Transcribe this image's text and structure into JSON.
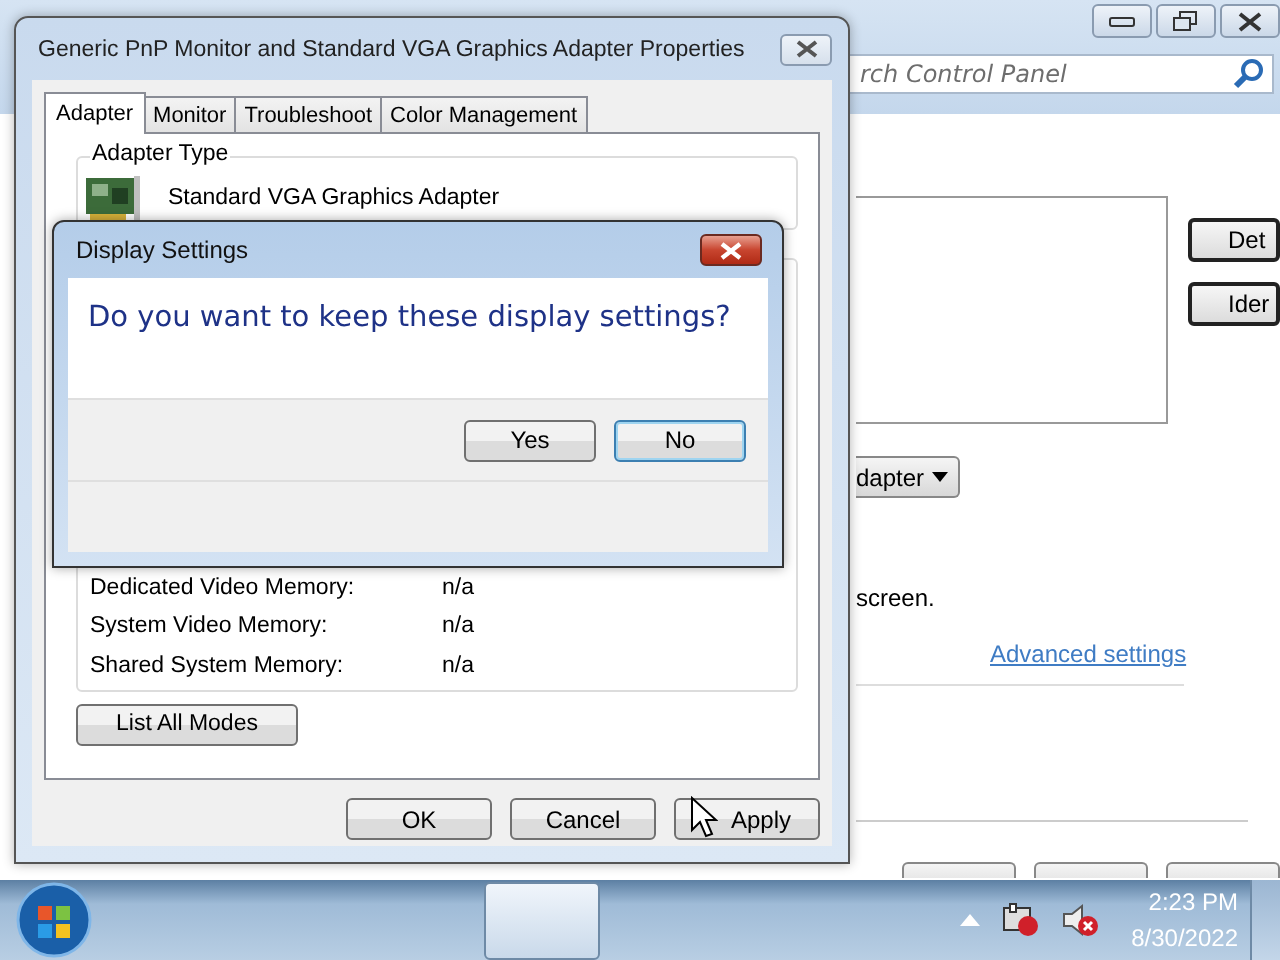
{
  "control_panel": {
    "search": {
      "placeholder": "rch Control Panel"
    },
    "side_buttons": [
      "Det",
      "Ider"
    ],
    "dropdown": {
      "value": "dapter"
    },
    "text": "screen.",
    "link": "Advanced settings"
  },
  "properties_dialog": {
    "title": "Generic PnP Monitor and Standard VGA Graphics Adapter Properties",
    "tabs": [
      {
        "label": "Adapter",
        "selected": true
      },
      {
        "label": "Monitor",
        "selected": false
      },
      {
        "label": "Troubleshoot",
        "selected": false
      },
      {
        "label": "Color Management",
        "selected": false
      }
    ],
    "adapter_type": {
      "legend": "Adapter Type",
      "name": "Standard VGA Graphics Adapter"
    },
    "memory": [
      {
        "label": "Dedicated Video Memory:",
        "value": "n/a"
      },
      {
        "label": "System Video Memory:",
        "value": "n/a"
      },
      {
        "label": "Shared System Memory:",
        "value": "n/a"
      }
    ],
    "list_button": "List All Modes",
    "buttons": [
      "OK",
      "Cancel",
      "Apply"
    ]
  },
  "display_settings_dialog": {
    "title": "Display Settings",
    "question": "Do you want to keep these display settings?",
    "buttons": [
      {
        "label": "Yes",
        "default": false
      },
      {
        "label": "No",
        "default": true
      }
    ]
  },
  "taskbar": {
    "clock": {
      "time": "2:23 PM",
      "date": "8/30/2022"
    }
  }
}
